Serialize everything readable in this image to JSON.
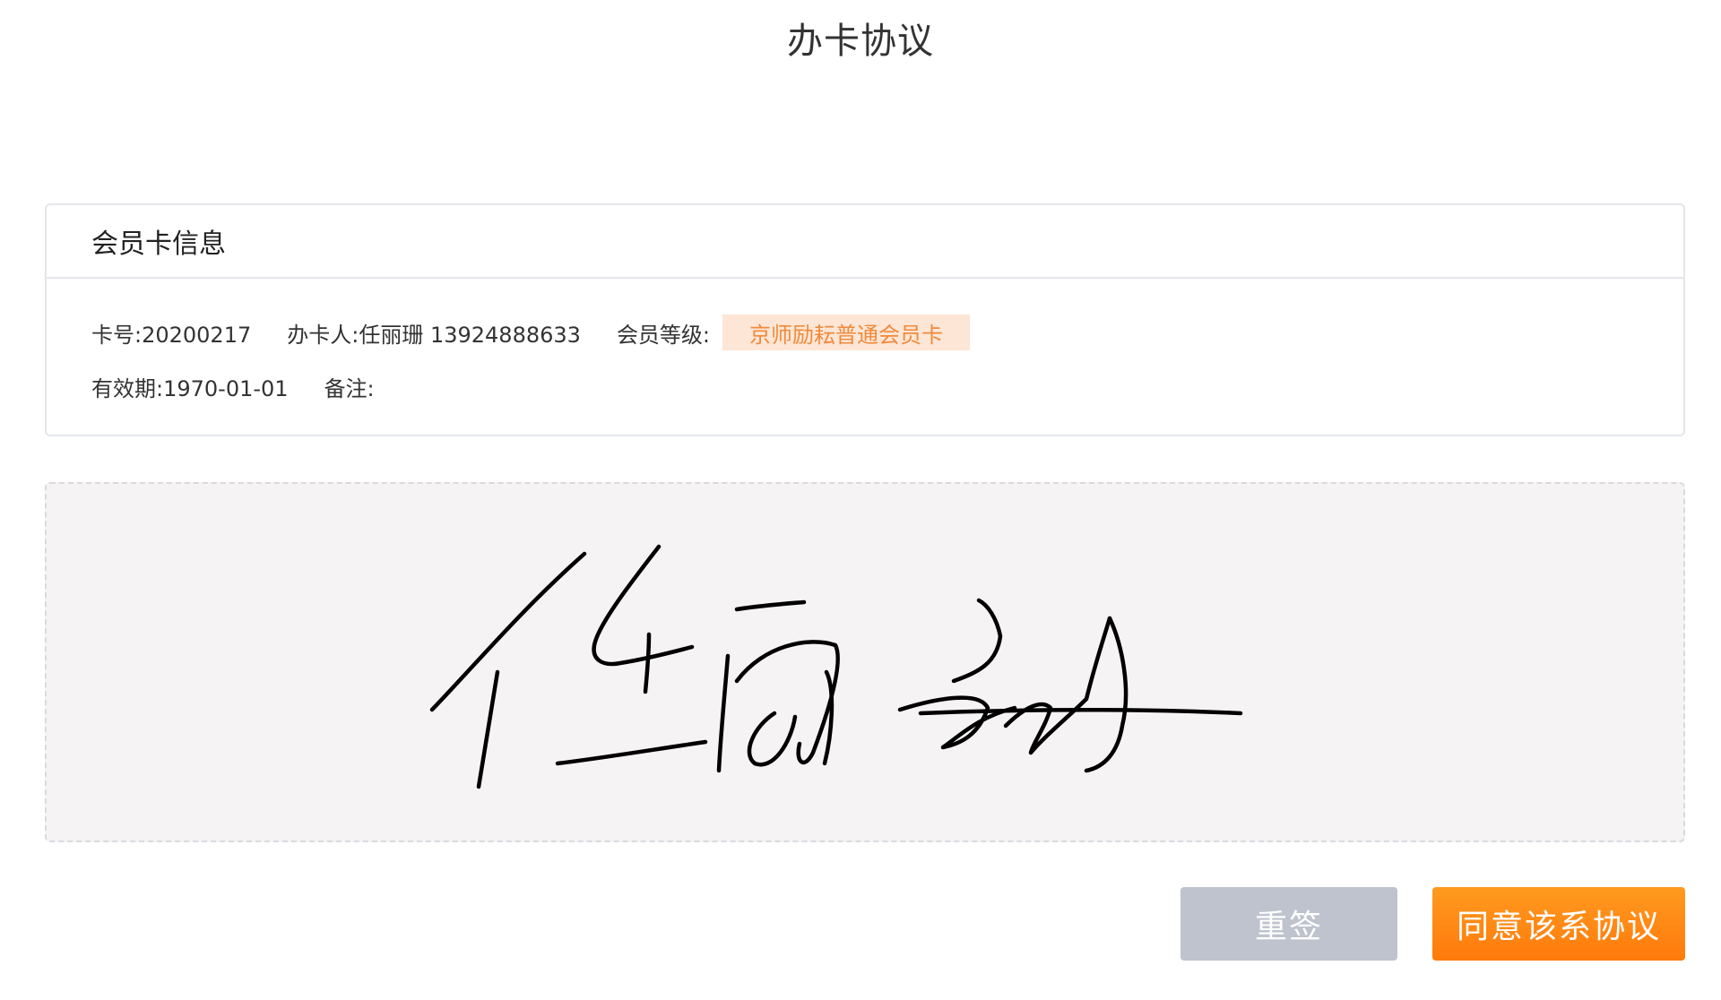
{
  "page": {
    "title": "办卡协议"
  },
  "card_info": {
    "header": "会员卡信息",
    "card_no": "卡号:20200217",
    "handler": "办卡人:任丽珊 13924888633",
    "level_label": "会员等级:",
    "level_value": "京师励耘普通会员卡",
    "validity": "有效期:1970-01-01",
    "remark": "备注:"
  },
  "signature": {
    "signed_name": "任丽珊",
    "stroke_color": "#000000"
  },
  "actions": {
    "resign_label": "重签",
    "agree_label": "同意该系协议"
  },
  "colors": {
    "accent": "#ff8a14",
    "badge_bg": "#fde6d6",
    "badge_text": "#f08a3c",
    "disabled_button": "#bfc3cd"
  }
}
